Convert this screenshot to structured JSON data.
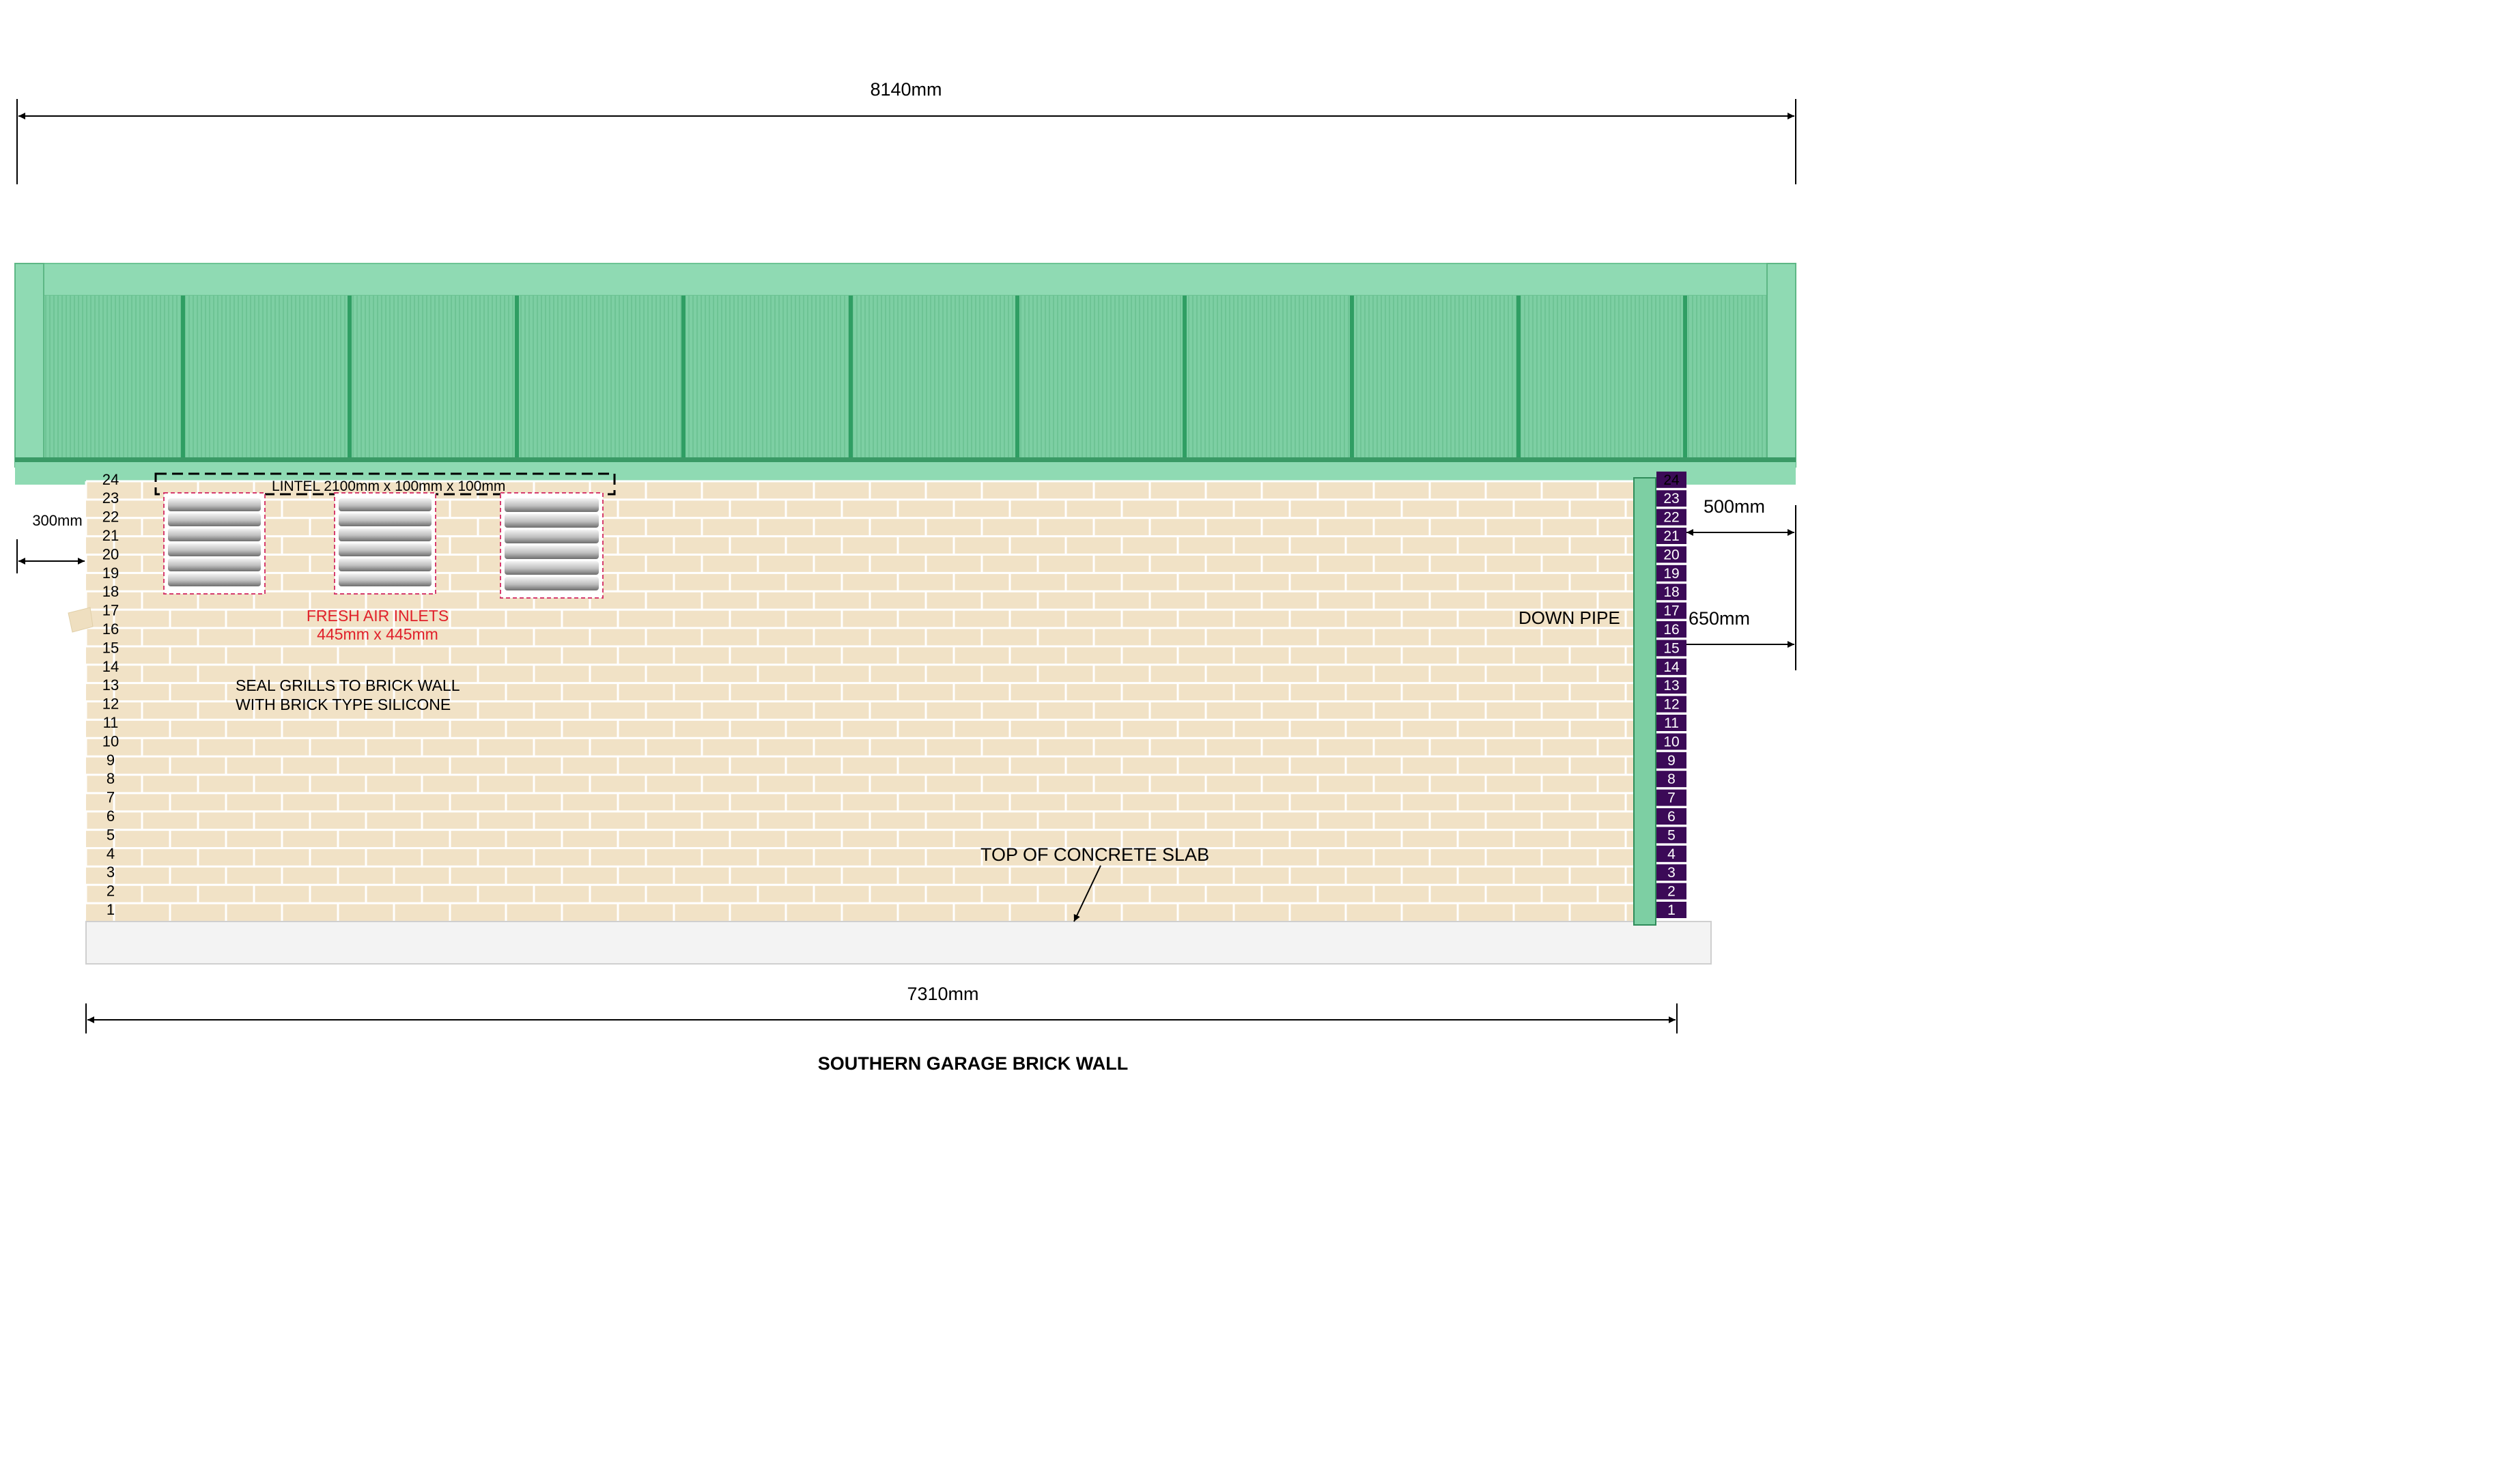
{
  "dimensions": {
    "overall_width": "8140mm",
    "wall_length": "7310mm",
    "left_offset": "300mm",
    "right_offset_upper": "500mm",
    "right_offset_lower": "650mm"
  },
  "labels": {
    "lintel": "LINTEL 2100mm x 100mm x 100mm",
    "fresh_air_title": "FRESH AIR INLETS",
    "fresh_air_size": "445mm x 445mm",
    "seal_line1": "SEAL GRILLS TO BRICK WALL",
    "seal_line2": "WITH BRICK TYPE SILICONE",
    "down_pipe": "DOWN PIPE",
    "concrete_slab": "TOP OF CONCRETE SLAB",
    "drawing_title": "SOUTHERN GARAGE BRICK WALL"
  },
  "course_numbers": [
    "1",
    "2",
    "3",
    "4",
    "5",
    "6",
    "7",
    "8",
    "9",
    "10",
    "11",
    "12",
    "13",
    "14",
    "15",
    "16",
    "17",
    "18",
    "19",
    "20",
    "21",
    "22",
    "23",
    "24"
  ],
  "colors": {
    "roof_green": "#7dcfa3",
    "roof_dark": "#2f9e63",
    "brick": "#f1e2c6",
    "mortar": "#ffffff",
    "pier_purple": "#3b0a57",
    "slab": "#f2f2f2",
    "inlet_text": "#e0202a"
  }
}
